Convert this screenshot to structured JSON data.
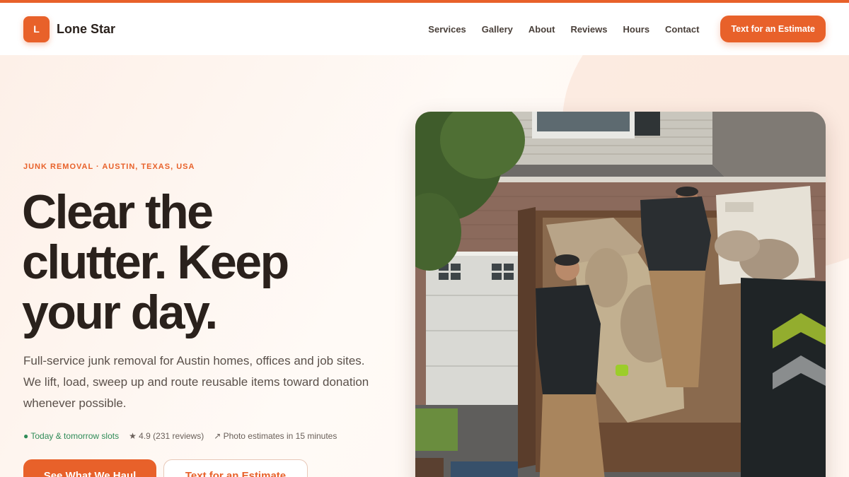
{
  "header": {
    "logo_letter": "L",
    "brand": "Lone Star",
    "nav": [
      "Services",
      "Gallery",
      "About",
      "Reviews",
      "Hours",
      "Contact"
    ],
    "cta": "Text for an Estimate"
  },
  "hero": {
    "eyebrow": "JUNK REMOVAL · AUSTIN, TEXAS, USA",
    "headline_1": "Clear the",
    "headline_2": "clutter. Keep",
    "headline_3": "your day.",
    "lead": "Full-service junk removal for Austin homes, offices and job sites. We lift, load, sweep up and route reusable items toward donation whenever possible.",
    "meta": {
      "slots": "● Today & tomorrow slots",
      "rating": "★ 4.9 (231 reviews)",
      "estimates": "↗ Photo estimates in 15 minutes"
    },
    "primary_button": "See What We Haul",
    "secondary_button": "Text for an Estimate"
  },
  "colors": {
    "accent": "#e8612a",
    "text": "#2a211c",
    "background": "#fff7f2"
  }
}
